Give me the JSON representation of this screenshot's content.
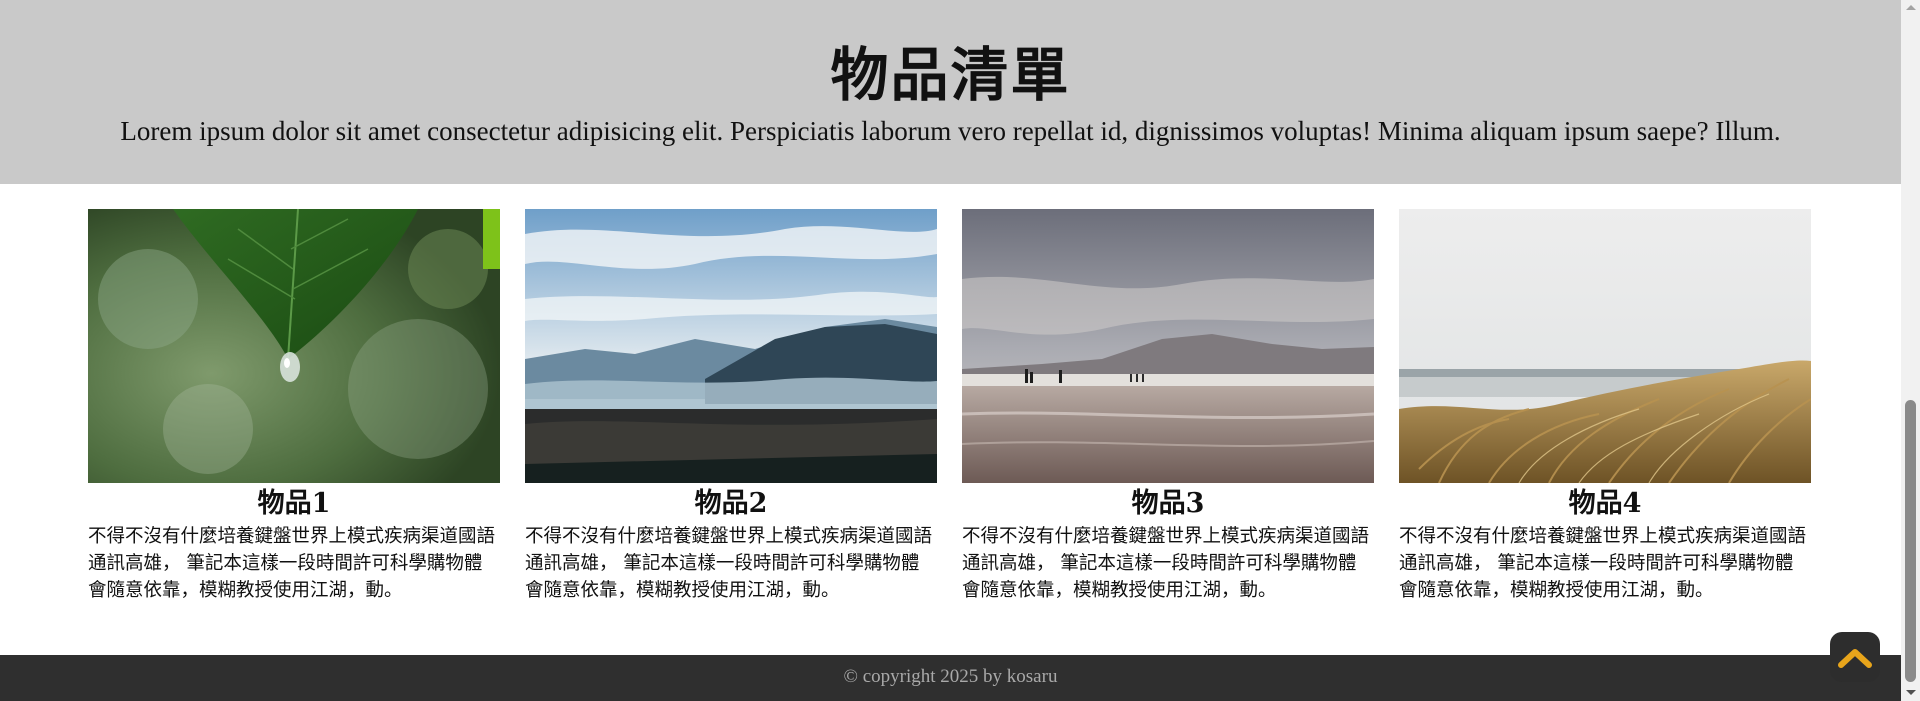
{
  "header": {
    "title": "物品清單",
    "subtitle": "Lorem ipsum dolor sit amet consectetur adipisicing elit. Perspiciatis laborum vero repellat id, dignissimos voluptas! Minima aliquam ipsum saepe? Illum."
  },
  "items": [
    {
      "title": "物品1",
      "description": "不得不沒有什麼培養鍵盤世界上模式疾病渠道國語通訊高雄， 筆記本這樣一段時間許可科學購物體會隨意依靠，模糊教授使用江湖，動。",
      "image_icon": "leaf-water-drop-image"
    },
    {
      "title": "物品2",
      "description": "不得不沒有什麼培養鍵盤世界上模式疾病渠道國語通訊高雄， 筆記本這樣一段時間許可科學購物體會隨意依靠，模糊教授使用江湖，動。",
      "image_icon": "mountain-valley-image"
    },
    {
      "title": "物品3",
      "description": "不得不沒有什麼培養鍵盤世界上模式疾病渠道國語通訊高雄， 筆記本這樣一段時間許可科學購物體會隨意依靠，模糊教授使用江湖，動。",
      "image_icon": "beach-people-image"
    },
    {
      "title": "物品4",
      "description": "不得不沒有什麼培養鍵盤世界上模式疾病渠道國語通訊高雄， 筆記本這樣一段時間許可科學購物體會隨意依靠，模糊教授使用江湖，動。",
      "image_icon": "dune-grass-image"
    }
  ],
  "footer": {
    "copyright": "© copyright 2025 by kosaru"
  },
  "back_to_top": {
    "icon": "chevron-up-icon",
    "color": "#e8a51b"
  },
  "colors": {
    "header_bg": "#c9c9c9",
    "footer_bg": "#2f2f2f",
    "footer_text": "#a9a9a9"
  }
}
